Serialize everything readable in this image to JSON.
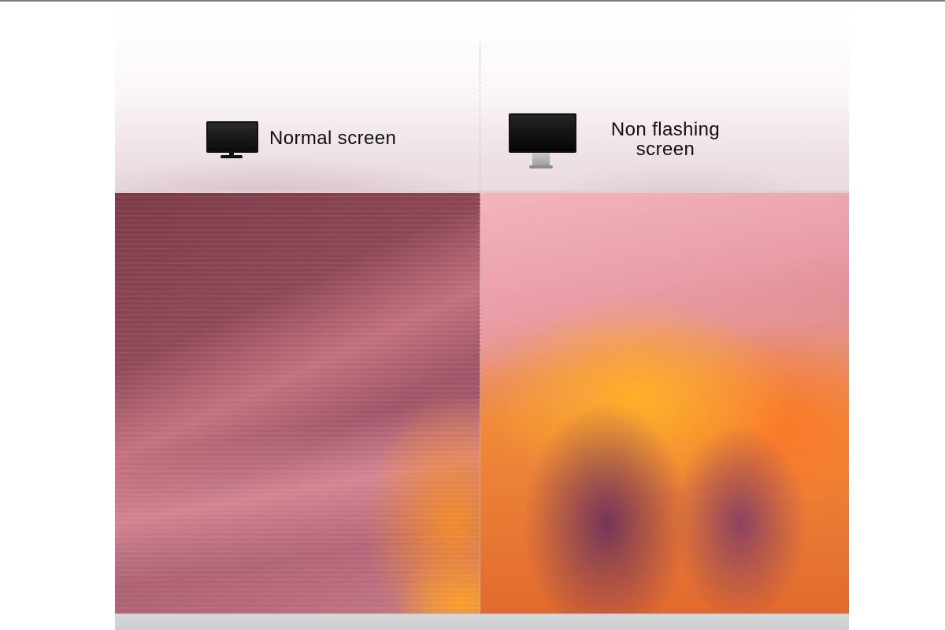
{
  "comparison": {
    "left": {
      "label": "Normal screen",
      "icon": "monitor-icon"
    },
    "right": {
      "label_line1": "Non flashing",
      "label_line2": "screen",
      "icon": "monitor-icon"
    }
  }
}
